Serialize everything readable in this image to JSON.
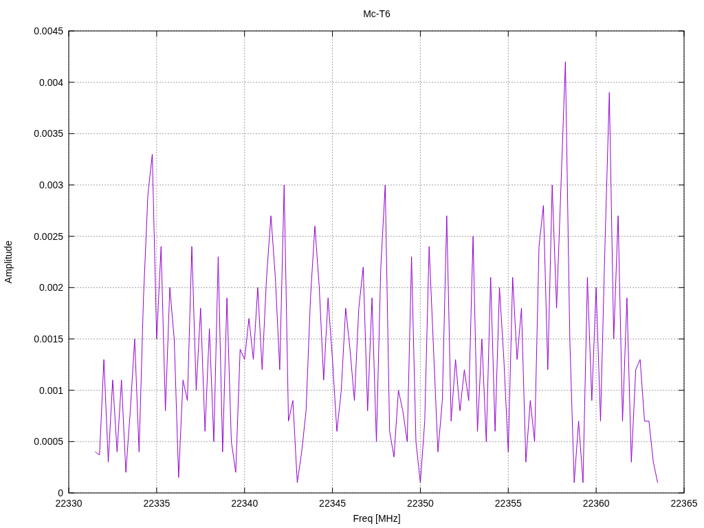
{
  "chart_data": {
    "type": "line",
    "title": "Mc-T6",
    "xlabel": "Freq [MHz]",
    "ylabel": "Amplitude",
    "grid": true,
    "xlim": [
      22330,
      22365
    ],
    "ylim": [
      0,
      0.0045
    ],
    "xticks": [
      22330,
      22335,
      22340,
      22345,
      22350,
      22355,
      22360,
      22365
    ],
    "yticks": [
      0,
      0.0005,
      0.001,
      0.0015,
      0.002,
      0.0025,
      0.003,
      0.0035,
      0.004,
      0.0045
    ],
    "x": [
      22331.5,
      22331.75,
      22332,
      22332.25,
      22332.5,
      22332.75,
      22333,
      22333.25,
      22333.5,
      22333.75,
      22334,
      22334.25,
      22334.5,
      22334.75,
      22335,
      22335.25,
      22335.5,
      22335.75,
      22336,
      22336.25,
      22336.5,
      22336.75,
      22337,
      22337.25,
      22337.5,
      22337.75,
      22338,
      22338.25,
      22338.5,
      22338.75,
      22339,
      22339.25,
      22339.5,
      22339.75,
      22340,
      22340.25,
      22340.5,
      22340.75,
      22341,
      22341.25,
      22341.5,
      22341.75,
      22342,
      22342.25,
      22342.5,
      22342.75,
      22343,
      22343.25,
      22343.5,
      22343.75,
      22344,
      22344.25,
      22344.5,
      22344.75,
      22345,
      22345.25,
      22345.5,
      22345.75,
      22346,
      22346.25,
      22346.5,
      22346.75,
      22347,
      22347.25,
      22347.5,
      22347.75,
      22348,
      22348.25,
      22348.5,
      22348.75,
      22349,
      22349.25,
      22349.5,
      22349.75,
      22350,
      22350.25,
      22350.5,
      22350.75,
      22351,
      22351.25,
      22351.5,
      22351.75,
      22352,
      22352.25,
      22352.5,
      22352.75,
      22353,
      22353.25,
      22353.5,
      22353.75,
      22354,
      22354.25,
      22354.5,
      22354.75,
      22355,
      22355.25,
      22355.5,
      22355.75,
      22356,
      22356.25,
      22356.5,
      22356.75,
      22357,
      22357.25,
      22357.5,
      22357.75,
      22358,
      22358.25,
      22358.5,
      22358.75,
      22359,
      22359.25,
      22359.5,
      22359.75,
      22360,
      22360.25,
      22360.5,
      22360.75,
      22361,
      22361.25,
      22361.5,
      22361.75,
      22362,
      22362.25,
      22362.5,
      22362.75,
      22363,
      22363.25,
      22363.5
    ],
    "series": [
      {
        "color": "#9400d3",
        "values": [
          0.0004,
          0.00037,
          0.0013,
          0.0003,
          0.0011,
          0.0004,
          0.0011,
          0.0002,
          0.0008,
          0.0015,
          0.0004,
          0.0019,
          0.0029,
          0.0033,
          0.0015,
          0.0024,
          0.0008,
          0.002,
          0.0015,
          0.00015,
          0.0011,
          0.0009,
          0.0024,
          0.001,
          0.0018,
          0.0006,
          0.0016,
          0.0005,
          0.0023,
          0.0004,
          0.0019,
          0.0005,
          0.0002,
          0.0014,
          0.0013,
          0.0017,
          0.0013,
          0.002,
          0.0012,
          0.0021,
          0.0027,
          0.0021,
          0.0012,
          0.003,
          0.0007,
          0.0009,
          0.0001,
          0.0004,
          0.0008,
          0.0019,
          0.0026,
          0.002,
          0.0011,
          0.0019,
          0.0013,
          0.0006,
          0.001,
          0.0018,
          0.0014,
          0.0009,
          0.0018,
          0.0022,
          0.0008,
          0.0019,
          0.0005,
          0.0022,
          0.003,
          0.0006,
          0.00035,
          0.001,
          0.0008,
          0.0005,
          0.0023,
          0.0005,
          0.0001,
          0.0007,
          0.0024,
          0.0014,
          0.0004,
          0.0009,
          0.0027,
          0.0007,
          0.0013,
          0.0008,
          0.0012,
          0.0009,
          0.0025,
          0.0006,
          0.0015,
          0.0005,
          0.0021,
          0.0006,
          0.002,
          0.0013,
          0.0004,
          0.0021,
          0.0013,
          0.0018,
          0.0003,
          0.0009,
          0.0005,
          0.0024,
          0.0028,
          0.0012,
          0.003,
          0.0018,
          0.003,
          0.0042,
          0.0015,
          0.0001,
          0.0007,
          0.0001,
          0.0021,
          0.0009,
          0.002,
          0.0007,
          0.0024,
          0.0039,
          0.0015,
          0.0027,
          0.0007,
          0.0019,
          0.0003,
          0.0012,
          0.0013,
          0.0007,
          0.0007,
          0.0003,
          0.0001
        ]
      }
    ]
  }
}
